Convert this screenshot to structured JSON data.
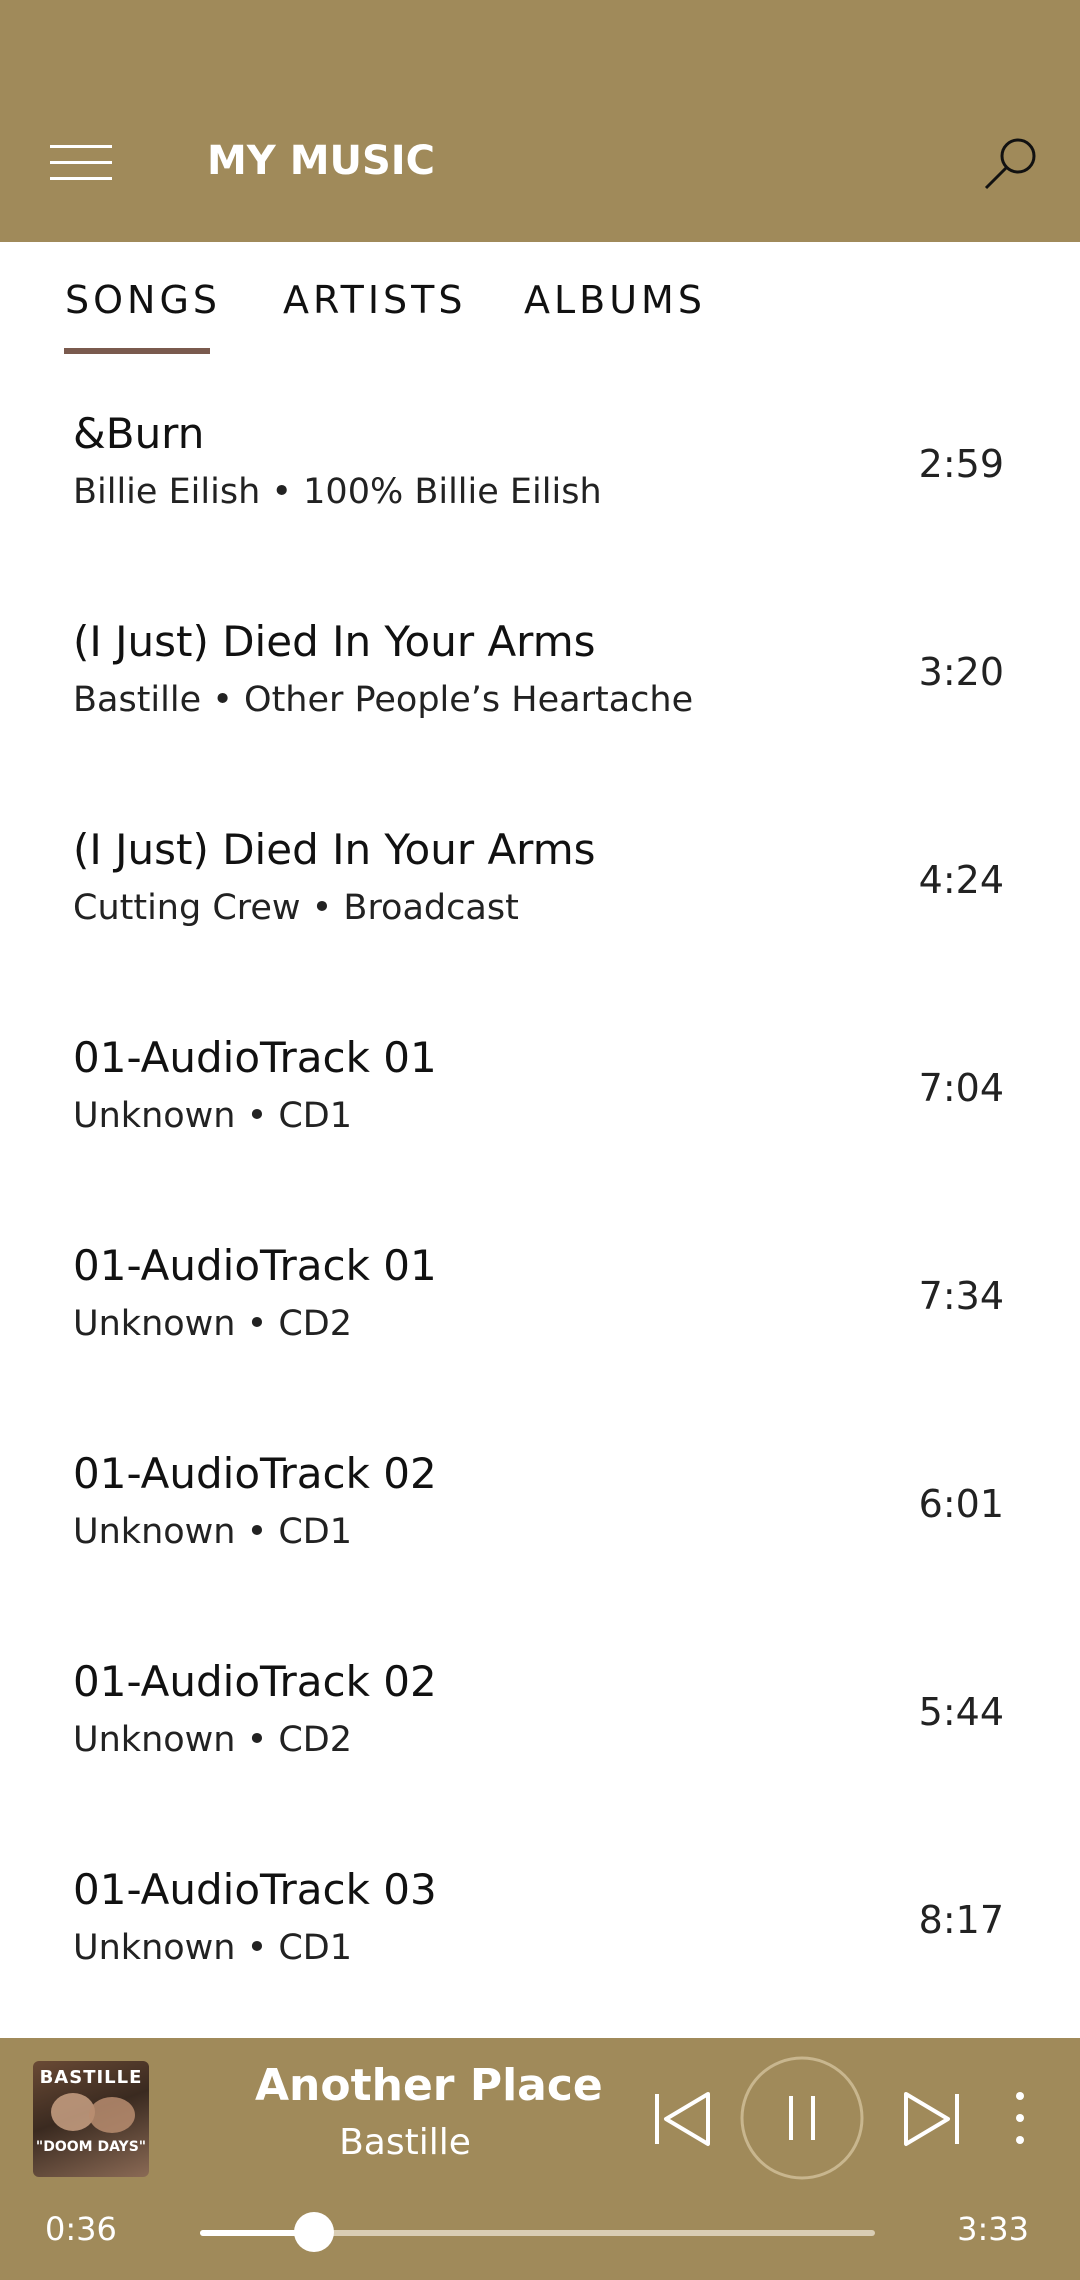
{
  "header": {
    "title": "MY MUSIC",
    "bg_color": "#a08a5a",
    "menu_icon": "hamburger-menu-icon",
    "search_icon": "search-icon"
  },
  "tabs": [
    {
      "label": "SONGS",
      "selected": true
    },
    {
      "label": "ARTISTS",
      "selected": false
    },
    {
      "label": "ALBUMS",
      "selected": false
    }
  ],
  "songs": [
    {
      "title": "&Burn",
      "subtitle": "Billie Eilish • 100% Billie Eilish",
      "duration": "2:59"
    },
    {
      "title": "(I Just) Died In Your Arms",
      "subtitle": "Bastille • Other People’s Heartache",
      "duration": "3:20"
    },
    {
      "title": "(I Just) Died In Your Arms",
      "subtitle": "Cutting Crew • Broadcast",
      "duration": "4:24"
    },
    {
      "title": "01-AudioTrack 01",
      "subtitle": "Unknown • CD1",
      "duration": "7:04"
    },
    {
      "title": "01-AudioTrack 01",
      "subtitle": "Unknown • CD2",
      "duration": "7:34"
    },
    {
      "title": "01-AudioTrack 02",
      "subtitle": "Unknown • CD1",
      "duration": "6:01"
    },
    {
      "title": "01-AudioTrack 02",
      "subtitle": "Unknown • CD2",
      "duration": "5:44"
    },
    {
      "title": "01-AudioTrack 03",
      "subtitle": "Unknown • CD1",
      "duration": "8:17"
    }
  ],
  "player": {
    "album_art_band": "BASTILLE",
    "album_art_title": "\"DOOM DAYS\"",
    "title": "Another Place",
    "artist": "Bastille",
    "current_time": "0:36",
    "total_time": "3:33",
    "progress": 0.169,
    "prev_icon": "skip-previous-icon",
    "pause_icon": "pause-icon",
    "next_icon": "skip-next-icon",
    "more_icon": "more-vertical-icon"
  }
}
